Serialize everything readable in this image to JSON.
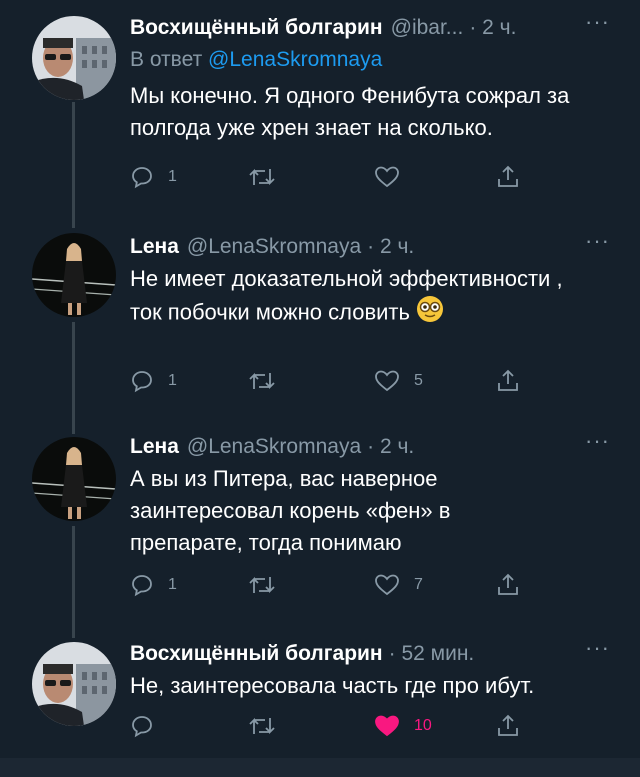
{
  "theme": {
    "background": "#15202b",
    "muted": "#8899a6",
    "link": "#1d9bf0",
    "like_active": "#f91880"
  },
  "tweets": [
    {
      "name": "Восхищённый болгарин",
      "handle": "@ibar...",
      "time": "· 2 ч.",
      "more": "···",
      "reply_prefix": "В ответ ",
      "reply_mention": "@LenaSkromnaya",
      "text": "Мы конечно. Я одного Фенибута сожрал за полгода уже хрен знает на сколько.",
      "replies": "1",
      "retweets": "",
      "likes": "",
      "avatar": "man-avatar"
    },
    {
      "name": "Lена",
      "handle": "@LenaSkromnaya",
      "time": "· 2 ч.",
      "more": "···",
      "text": "Не имеет доказательной эффективности , ток побочки можно словить",
      "emoji": "face-with-monocle",
      "replies": "1",
      "retweets": "",
      "likes": "5",
      "avatar": "woman-avatar"
    },
    {
      "name": "Lена",
      "handle": "@LenaSkromnaya",
      "time": "· 2 ч.",
      "more": "···",
      "text": "А вы из Питера, вас наверное заинтересовал корень «фен» в препарате, тогда понимаю",
      "replies": "1",
      "retweets": "",
      "likes": "7",
      "avatar": "woman-avatar"
    },
    {
      "name": "Восхищённый болгарин",
      "handle": "",
      "time": "· 52 мин.",
      "more": "···",
      "text": "Не, заинтересовала часть где про ибут.",
      "replies": "",
      "retweets": "",
      "likes": "10",
      "liked": true,
      "avatar": "man-avatar"
    }
  ]
}
